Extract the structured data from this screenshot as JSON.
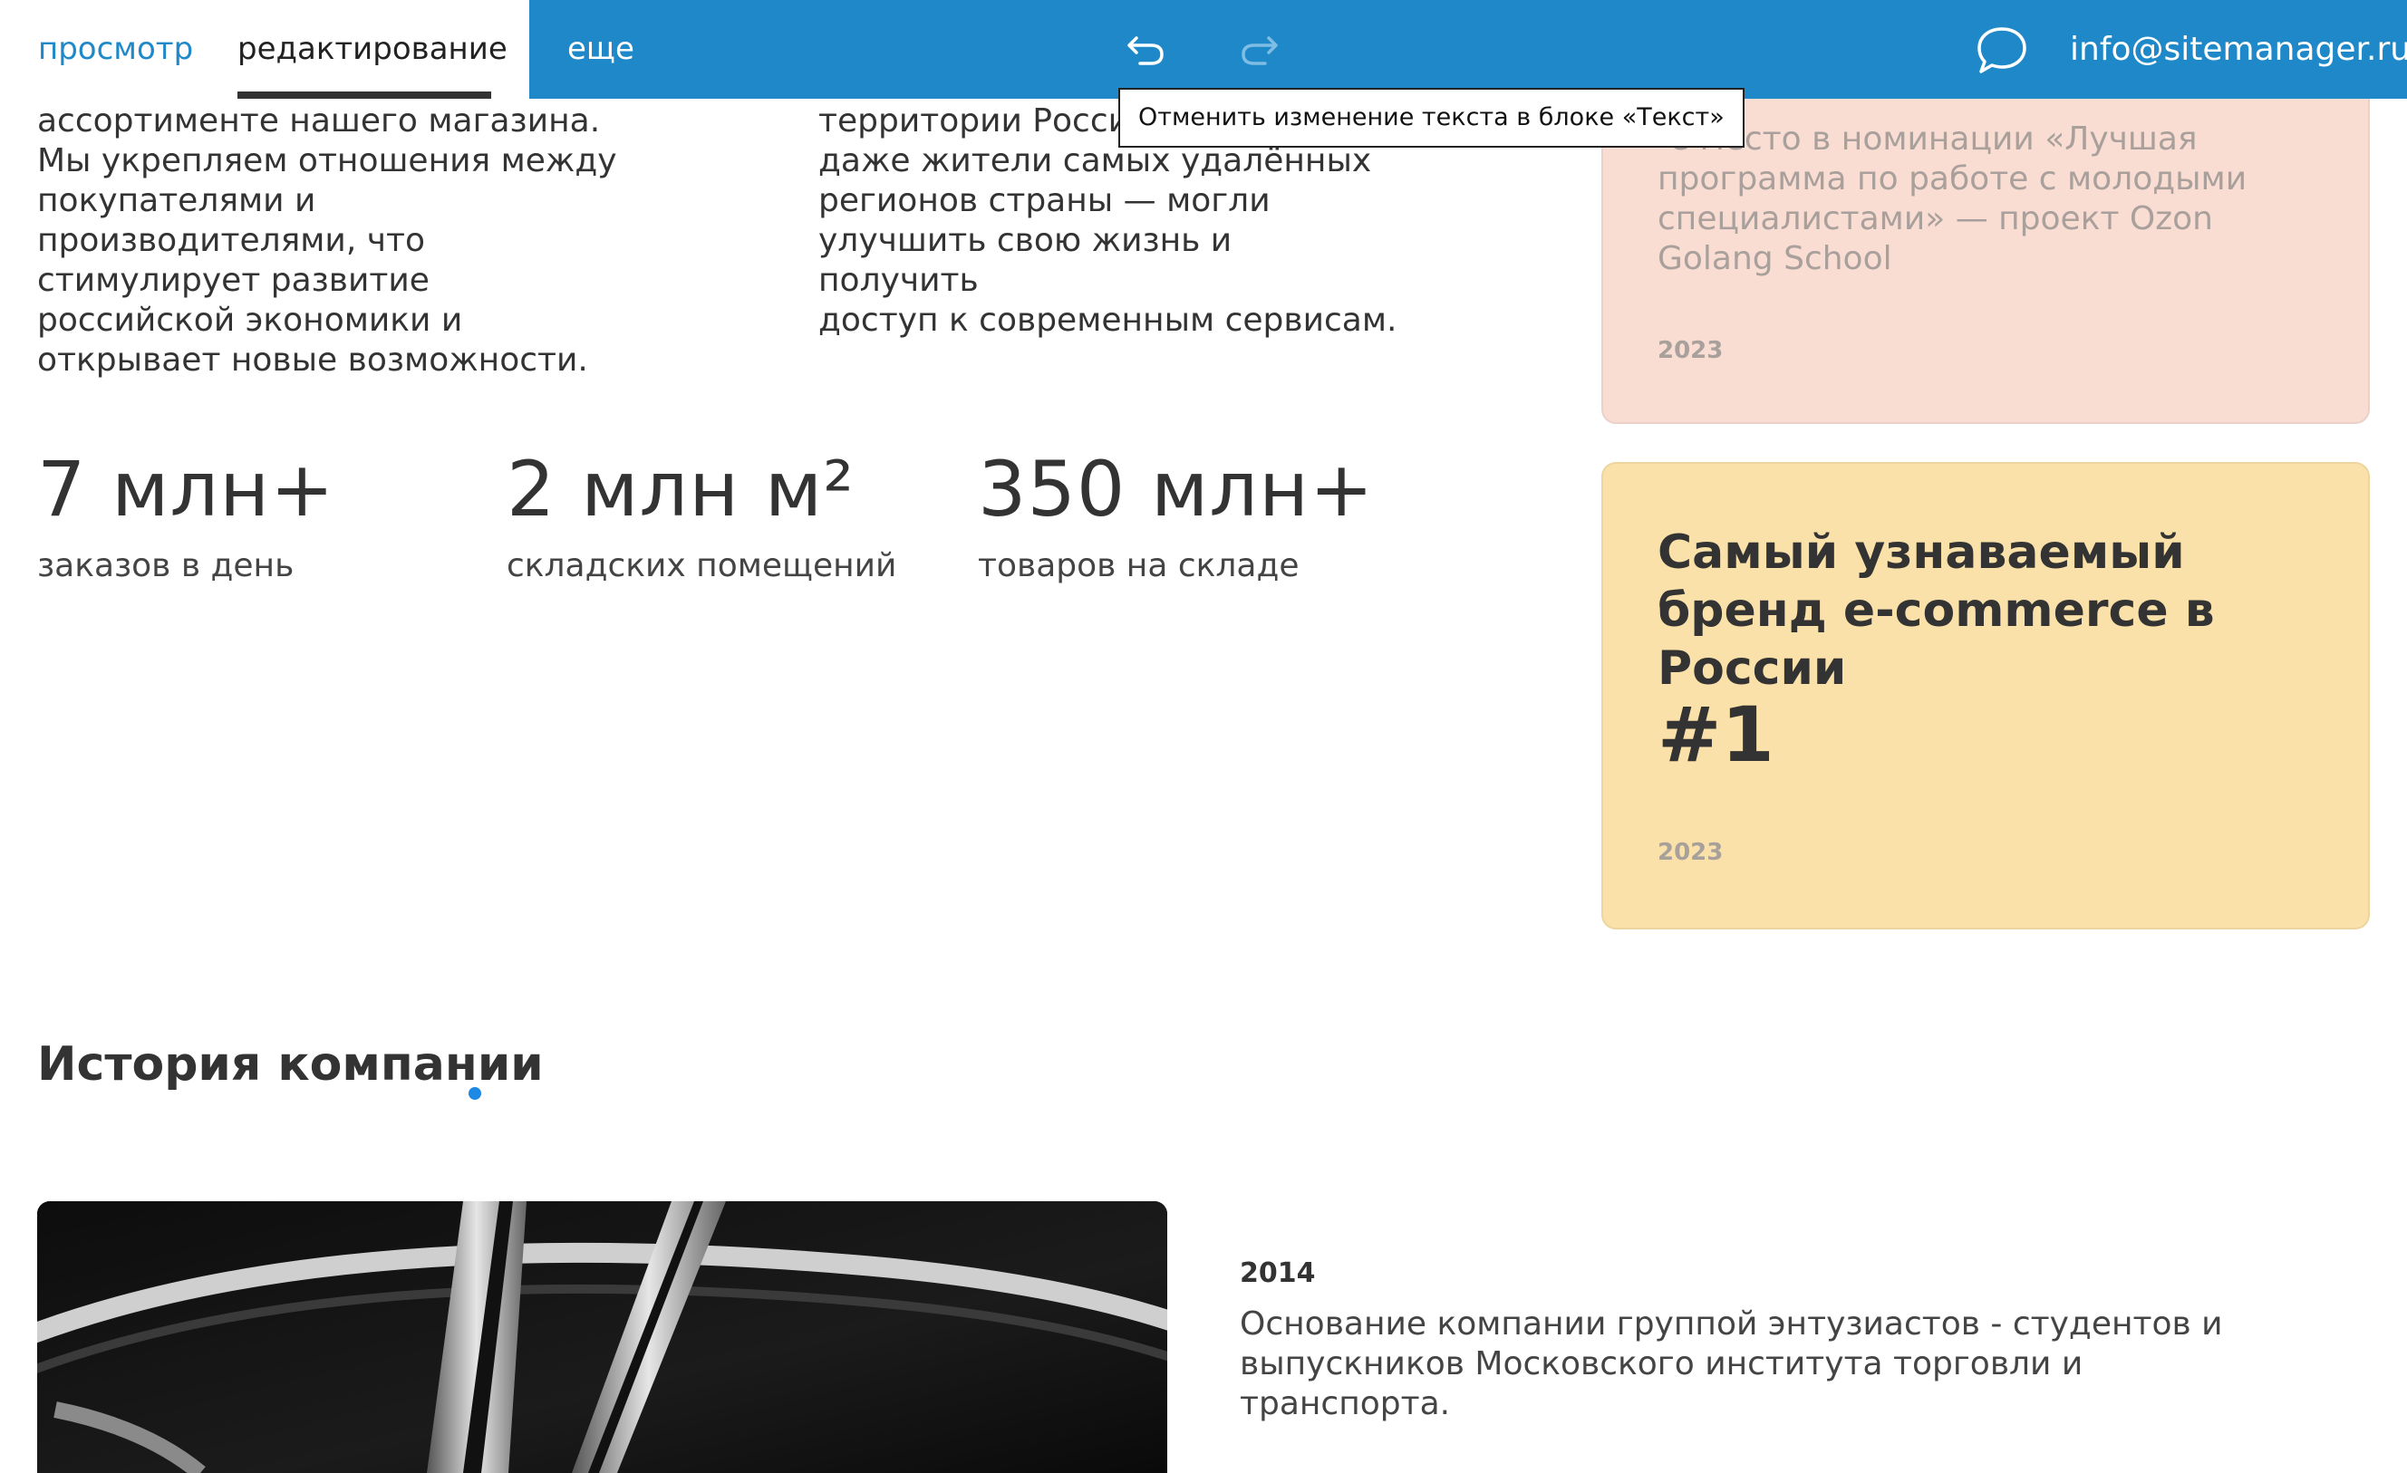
{
  "toolbar": {
    "tab_view": "просмотр",
    "tab_edit": "редактирование",
    "tab_more": "еще",
    "email": "info@sitemanager.ru",
    "undo_tooltip": "Отменить изменение текста в блоке «Текст»",
    "icons": [
      "undo-icon",
      "redo-icon",
      "chat-bubble-icon"
    ],
    "colors": {
      "bar": "#1e88c8",
      "active_tab_underline": "#333333"
    }
  },
  "intro": {
    "left_text": "ассортименте нашего магазина.\nМы укрепляем отношения между\nпокупателями и\nпроизводителями, что\nстимулирует развитие\nроссийской экономики и\nоткрывает новые возможности.",
    "mid_text": "территории России\nдаже жители самых удалённых\nрегионов страны — могли\nулучшить свою жизнь и получить\nдоступ к современным сервисам."
  },
  "stats": [
    {
      "value": "7 млн+",
      "label": "заказов в день"
    },
    {
      "value": "2 млн м²",
      "label": "складских помещений"
    },
    {
      "value": "350 млн+",
      "label": "товаров на складе"
    }
  ],
  "cards": {
    "nomination": {
      "text": "-е место в номинации «Лучшая программа по работе с молодыми специалистами» — проект Ozon Golang School",
      "year": "2023",
      "color": "#f9ddd3"
    },
    "brand": {
      "title": "Самый узнаваемый бренд e-commerce в России",
      "rank": "#1",
      "year": "2023",
      "color": "#fae1a9"
    }
  },
  "history": {
    "title": "История компании",
    "year": "2014",
    "text": "Основание компании группой энтузиастов - студентов и выпускников Московского института торговли и транспорта."
  }
}
